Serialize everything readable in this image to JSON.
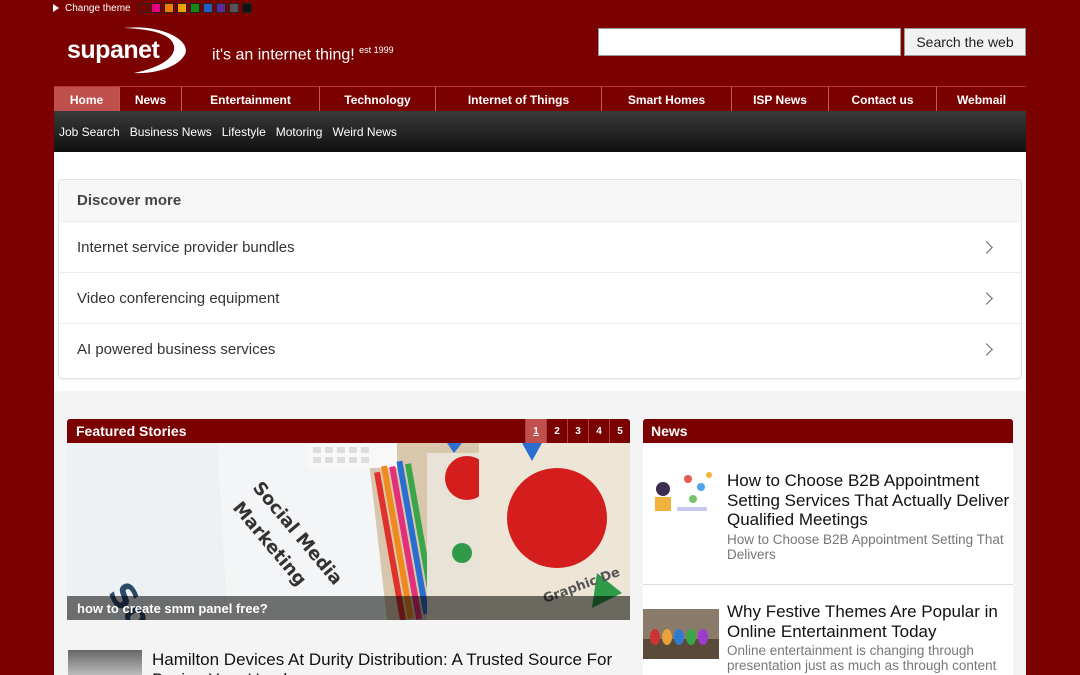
{
  "theme": {
    "label": "Change theme",
    "swatches": [
      "#7b0000",
      "#e4007c",
      "#f07c00",
      "#f0a000",
      "#128a12",
      "#1f5fc0",
      "#5a2a9a",
      "#555555",
      "#111111"
    ]
  },
  "brand": {
    "logo": "supanet",
    "tagline": "it's an internet thing!",
    "est": "est 1999"
  },
  "search": {
    "value": "",
    "button": "Search the web"
  },
  "nav": [
    "Home",
    "News",
    "Entertainment",
    "Technology",
    "Internet of Things",
    "Smart Homes",
    "ISP News",
    "Contact us",
    "Webmail"
  ],
  "subnav": [
    "Job Search",
    "Business News",
    "Lifestyle",
    "Motoring",
    "Weird News"
  ],
  "discover": {
    "title": "Discover more",
    "items": [
      "Internet service provider bundles",
      "Video conferencing equipment",
      "AI powered business services"
    ]
  },
  "featured": {
    "title": "Featured Stories",
    "pages": [
      "1",
      "2",
      "3",
      "4",
      "5"
    ],
    "active_page": "1",
    "caption": "how to create smm panel free?",
    "story_title": "Hamilton Devices At Durity Distribution: A Trusted Source For Buying Your Used"
  },
  "news": {
    "title": "News",
    "items": [
      {
        "title": "How to Choose B2B Appointment Setting Services That Actually Deliver Qualified Meetings",
        "snippet": "How to Choose B2B Appointment Setting That Delivers"
      },
      {
        "title": "Why Festive Themes Are Popular in Online Entertainment Today",
        "snippet": "Online entertainment is changing through presentation just as much as through content"
      }
    ]
  }
}
